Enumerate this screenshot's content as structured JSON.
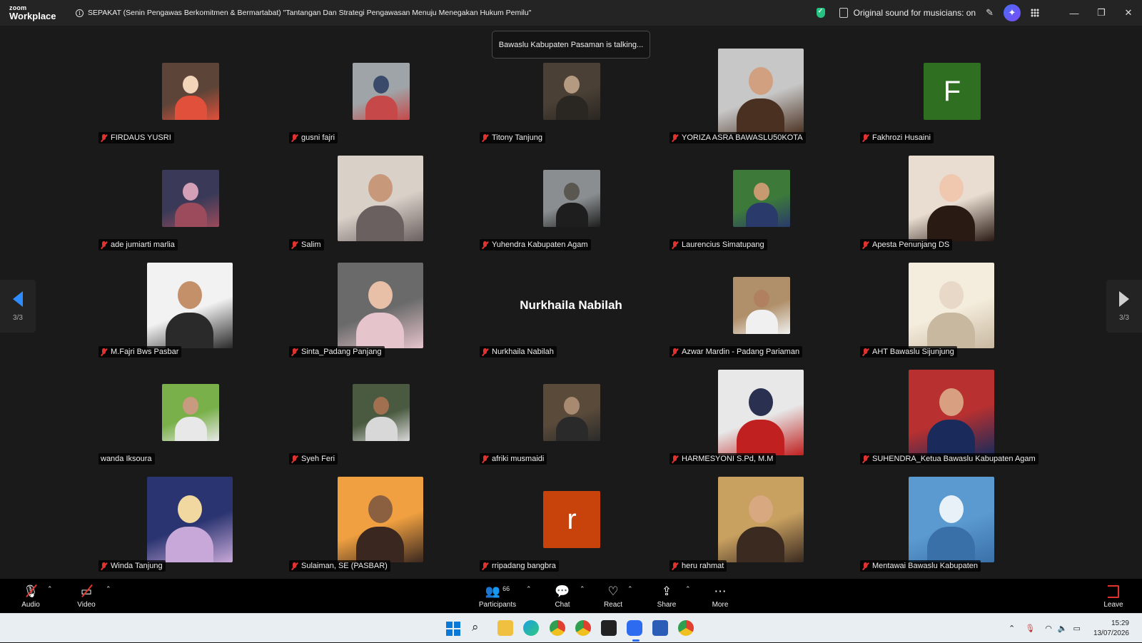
{
  "app": {
    "brand_top": "zoom",
    "brand_bottom": "Workplace",
    "meeting_title": "SEPAKAT (Senin Pengawas Berkomitmen & Bermartabat) \"Tantangan Dan Strategi Pengawasan Menuju Menegakan Hukum Pemilu\"",
    "sound_status": "Original sound for musicians: on"
  },
  "talking_banner": "Bawaslu Kabupaten Pasaman is talking...",
  "pagination": {
    "left": "3/3",
    "right": "3/3"
  },
  "participants": [
    {
      "name": "FIRDAUS YUSRI",
      "kind": "photo",
      "size": "small",
      "colors": [
        "#5c4438",
        "#e0503a",
        "#f2d4b8"
      ]
    },
    {
      "name": "gusni fajri",
      "kind": "photo",
      "size": "small",
      "colors": [
        "#9fa4a8",
        "#c64848",
        "#3a4a6a"
      ]
    },
    {
      "name": "Titony Tanjung",
      "kind": "photo",
      "size": "small",
      "colors": [
        "#4a4035",
        "#2a2622",
        "#b49a80"
      ]
    },
    {
      "name": "YORIZA ASRA BAWASLU50KOTA",
      "kind": "photo",
      "size": "large",
      "colors": [
        "#c7c7c7",
        "#4a3020",
        "#d0a080"
      ]
    },
    {
      "name": "Fakhrozi Husaini",
      "kind": "initial",
      "size": "small",
      "initial": "F",
      "color": "#2f6f22"
    },
    {
      "name": "ade jumiarti marlia",
      "kind": "photo",
      "size": "small",
      "colors": [
        "#3a3a58",
        "#9b4b5b",
        "#d4a0b8"
      ]
    },
    {
      "name": "Salim",
      "kind": "photo",
      "size": "large",
      "colors": [
        "#d9d0c8",
        "#6a6060",
        "#c8987a"
      ]
    },
    {
      "name": "Yuhendra Kabupaten Agam",
      "kind": "photo",
      "size": "small",
      "colors": [
        "#8a8e90",
        "#1e1e1e",
        "#5a5650"
      ]
    },
    {
      "name": "Laurencius Simatupang",
      "kind": "photo",
      "size": "small",
      "colors": [
        "#3d7a3a",
        "#2a3a6a",
        "#c89a70"
      ]
    },
    {
      "name": "Apesta Penunjang DS",
      "kind": "photo",
      "size": "large",
      "colors": [
        "#e8ddd0",
        "#2a1a14",
        "#f0c8b0"
      ]
    },
    {
      "name": "M.Fajri Bws Pasbar",
      "kind": "photo",
      "size": "large",
      "colors": [
        "#f2f2f2",
        "#2a2a2a",
        "#c4906a"
      ]
    },
    {
      "name": "Sinta_Padang Panjang",
      "kind": "photo",
      "size": "large",
      "colors": [
        "#6a6a6a",
        "#e6c4cc",
        "#e8c0a8"
      ]
    },
    {
      "name": "Nurkhaila Nabilah",
      "kind": "name",
      "size": "large"
    },
    {
      "name": "Azwar Mardin - Padang Pariaman",
      "kind": "photo",
      "size": "small",
      "colors": [
        "#b0906a",
        "#f0f0f0",
        "#b08060"
      ]
    },
    {
      "name": "AHT Bawaslu Sijunjung",
      "kind": "photo",
      "size": "large",
      "colors": [
        "#f4ecdc",
        "#c8b8a0",
        "#e8d8c8"
      ]
    },
    {
      "name": "wanda Iksoura",
      "kind": "photo",
      "size": "small",
      "colors": [
        "#7ab04a",
        "#e8e8e8",
        "#c89a80"
      ]
    },
    {
      "name": "Syeh Feri",
      "kind": "photo",
      "size": "small",
      "colors": [
        "#4a5a40",
        "#d8d8d8",
        "#a07050"
      ]
    },
    {
      "name": "afriki musmaidi",
      "kind": "photo",
      "size": "small",
      "colors": [
        "#5a4a3a",
        "#2a2a2a",
        "#a88a70"
      ]
    },
    {
      "name": "HARMESYONI S.Pd, M.M",
      "kind": "photo",
      "size": "large",
      "colors": [
        "#e8e8e8",
        "#c02020",
        "#2a3050"
      ]
    },
    {
      "name": "SUHENDRA_Ketua Bawaslu Kabupaten Agam",
      "kind": "photo",
      "size": "large",
      "colors": [
        "#b83030",
        "#1a2a5a",
        "#d8a080"
      ]
    },
    {
      "name": "Winda Tanjung",
      "kind": "photo",
      "size": "large",
      "colors": [
        "#2a3470",
        "#c8a8d8",
        "#f0d8a0"
      ]
    },
    {
      "name": "Sulaiman, SE (PASBAR)",
      "kind": "photo",
      "size": "large",
      "colors": [
        "#f0a040",
        "#3a2820",
        "#8a6040"
      ]
    },
    {
      "name": "rripadang bangbra",
      "kind": "initial",
      "size": "small",
      "initial": "r",
      "color": "#c8420c"
    },
    {
      "name": "heru rahmat",
      "kind": "photo",
      "size": "large",
      "colors": [
        "#c8a060",
        "#3a2a20",
        "#d8a880"
      ]
    },
    {
      "name": "Mentawai Bawaslu Kabupaten",
      "kind": "photo",
      "size": "large",
      "colors": [
        "#5a9ad0",
        "#3a70a8",
        "#e8f0f8"
      ]
    }
  ],
  "toolbar": {
    "audio": "Audio",
    "video": "Video",
    "participants": "Participants",
    "participants_count": "66",
    "chat": "Chat",
    "react": "React",
    "share": "Share",
    "more": "More",
    "leave": "Leave"
  },
  "taskbar": {
    "time": "15:29",
    "date": "13/07/2026"
  }
}
